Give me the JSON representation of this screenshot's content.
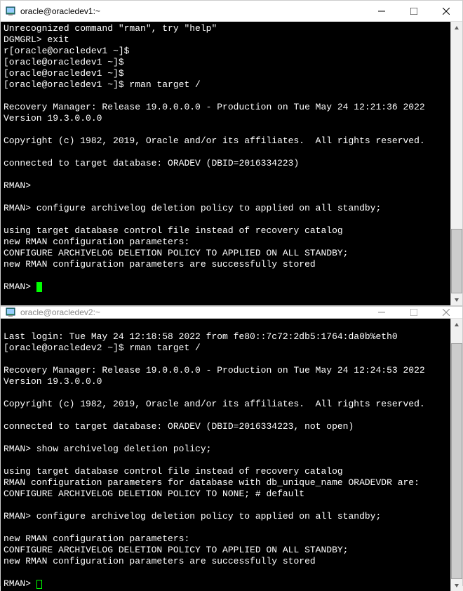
{
  "window1": {
    "title": "oracle@oracledev1:~",
    "lines": [
      "Unrecognized command \"rman\", try \"help\"",
      "DGMGRL> exit",
      "r[oracle@oracledev1 ~]$",
      "[oracle@oracledev1 ~]$",
      "[oracle@oracledev1 ~]$",
      "[oracle@oracledev1 ~]$ rman target /",
      "",
      "Recovery Manager: Release 19.0.0.0.0 - Production on Tue May 24 12:21:36 2022",
      "Version 19.3.0.0.0",
      "",
      "Copyright (c) 1982, 2019, Oracle and/or its affiliates.  All rights reserved.",
      "",
      "connected to target database: ORADEV (DBID=2016334223)",
      "",
      "RMAN>",
      "",
      "RMAN> configure archivelog deletion policy to applied on all standby;",
      "",
      "using target database control file instead of recovery catalog",
      "new RMAN configuration parameters:",
      "CONFIGURE ARCHIVELOG DELETION POLICY TO APPLIED ON ALL STANDBY;",
      "new RMAN configuration parameters are successfully stored",
      "",
      "RMAN> "
    ],
    "scroll_thumb_top_pct": 75,
    "scroll_thumb_height_pct": 25
  },
  "window2": {
    "title": "oracle@oracledev2:~",
    "lines": [
      "",
      "Last login: Tue May 24 12:18:58 2022 from fe80::7c72:2db5:1764:da0b%eth0",
      "[oracle@oracledev2 ~]$ rman target /",
      "",
      "Recovery Manager: Release 19.0.0.0.0 - Production on Tue May 24 12:24:53 2022",
      "Version 19.3.0.0.0",
      "",
      "Copyright (c) 1982, 2019, Oracle and/or its affiliates.  All rights reserved.",
      "",
      "connected to target database: ORADEV (DBID=2016334223, not open)",
      "",
      "RMAN> show archivelog deletion policy;",
      "",
      "using target database control file instead of recovery catalog",
      "RMAN configuration parameters for database with db_unique_name ORADEVDR are:",
      "CONFIGURE ARCHIVELOG DELETION POLICY TO NONE; # default",
      "",
      "RMAN> configure archivelog deletion policy to applied on all standby;",
      "",
      "new RMAN configuration parameters:",
      "CONFIGURE ARCHIVELOG DELETION POLICY TO APPLIED ON ALL STANDBY;",
      "new RMAN configuration parameters are successfully stored",
      "",
      "RMAN> "
    ],
    "scroll_thumb_top_pct": 5,
    "scroll_thumb_height_pct": 95
  },
  "icons": {
    "putty": "putty-icon",
    "minimize": "minimize-icon",
    "maximize": "maximize-icon",
    "close": "close-icon",
    "scroll_up": "scroll-up-icon",
    "scroll_down": "scroll-down-icon"
  }
}
